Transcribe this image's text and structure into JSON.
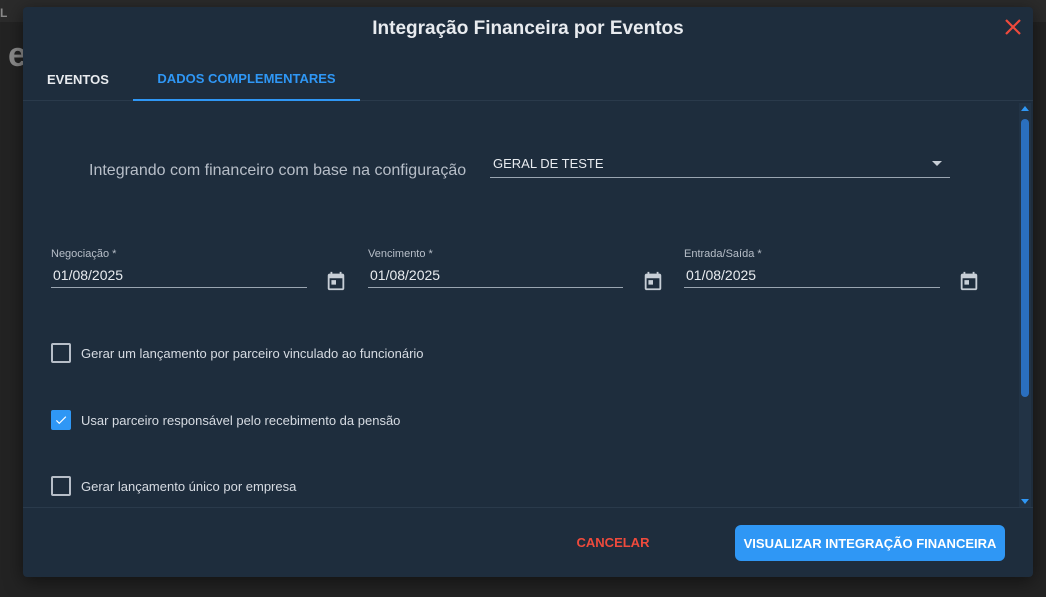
{
  "background": {
    "letter_top": "L",
    "letter_big": "e"
  },
  "modal": {
    "title": "Integração Financeira por Eventos",
    "close_icon": "close-icon",
    "tabs": [
      {
        "label": "EVENTOS",
        "active": false
      },
      {
        "label": "DADOS COMPLEMENTARES",
        "active": true
      }
    ],
    "config": {
      "label": "Integrando com financeiro com base na configuração",
      "value": "GERAL DE TESTE"
    },
    "dates": [
      {
        "label": "Negociação *",
        "value": "01/08/2025"
      },
      {
        "label": "Vencimento *",
        "value": "01/08/2025"
      },
      {
        "label": "Entrada/Saída *",
        "value": "01/08/2025"
      }
    ],
    "checkboxes": [
      {
        "label": "Gerar um lançamento por parceiro vinculado ao funcionário",
        "checked": false
      },
      {
        "label": "Usar parceiro responsável pelo recebimento da pensão",
        "checked": true
      },
      {
        "label": "Gerar lançamento único por empresa",
        "checked": false
      }
    ],
    "footer": {
      "cancel_label": "CANCELAR",
      "primary_label": "VISUALIZAR INTEGRAÇÃO FINANCEIRA"
    }
  },
  "colors": {
    "accent": "#2f97f5",
    "danger": "#ef4a3c",
    "modal_bg": "#1e2d3d"
  }
}
